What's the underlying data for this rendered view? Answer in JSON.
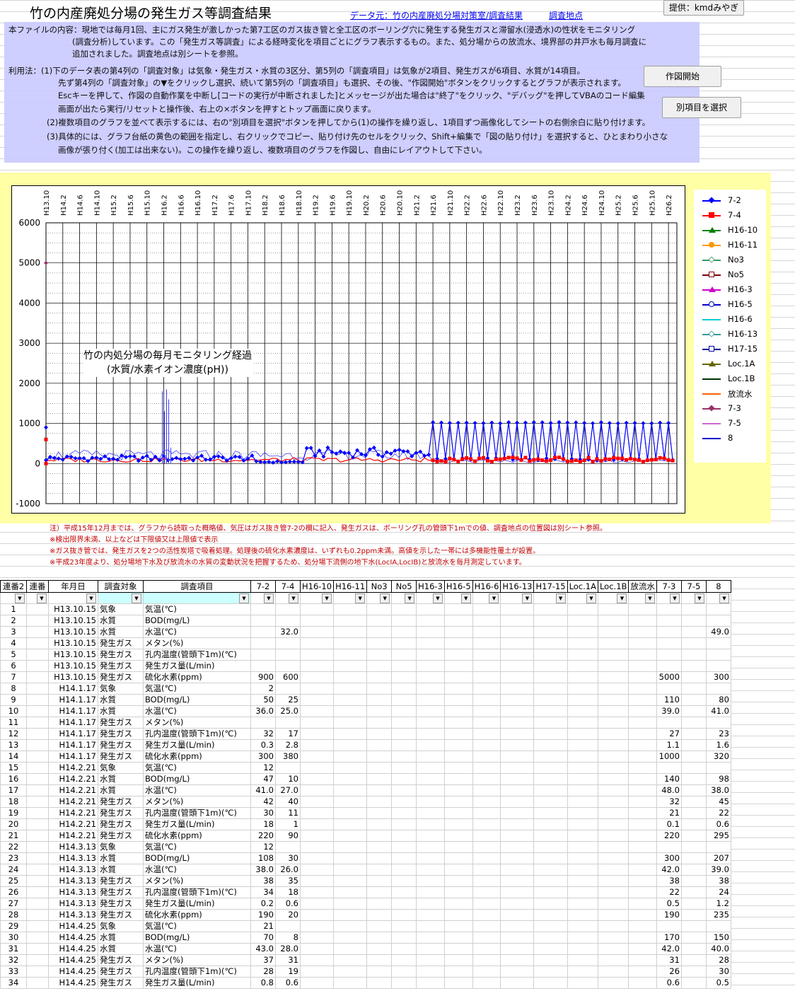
{
  "header": {
    "title": "竹の内産廃処分場の発生ガス等調査結果",
    "source_link": "データ元：竹の内産廃処分場対策室/調査結果",
    "location_link": "調査地点",
    "provider": "提供：kmdみやぎ"
  },
  "buttons": {
    "draw": "作図開始",
    "select": "別項目を選択"
  },
  "description": [
    "本ファイルの内容：現地では毎月1回、主にガス発生が激しかった第7工区のガス抜き管と全工区のボーリング穴に発生する発生ガスと滞留水(浸透水)の性状をモニタリング",
    "(調査分析)しています。この「発生ガス等調査」による経時変化を項目ごとにグラフ表示するもの。また、処分場からの放流水、境界部の井戸水も毎月調査に",
    "追加されました。調査地点は別シートを参照。",
    "利用法：(1)下のデータ表の第4列の「調査対象」は気象・発生ガス・水質の3区分、第5列の「調査項目」は気象が2項目、発生ガスが6項目、水質が14項目。",
    "先ず第4列の「調査対象」の▼をクリックし選択、続いて第5列の「調査項目」も選択、その後、\"作図開始\"ボタンをクリックするとグラフが表示されます。",
    "Escキーを押して、作図の自動作業を中断し[コードの実行が中断されました]とメッセージが出た場合は\"終了\"をクリック、\"デバッグ\"を押してVBAのコード編集",
    "画面が出たら実行/リセットと操作後、右上の×ボタンを押すとトップ画面に戻ります。",
    "(2)複数項目のグラフを並べて表示するには、右の\"別項目を選択\"ボタンを押してから(1)の操作を繰り返し、1項目ずつ画像化してシートの右側余白に貼り付けます。",
    "(3)具体的には、グラフ台紙の黄色の範囲を指定し、右クリックでコピー、貼り付け先のセルをクリック、Shift+編集で「図の貼り付け」を選択すると、ひとまわり小さな",
    "画像が張り付く(加工は出来ない)。この操作を繰り返し、複数項目のグラフを作図し、自由にレイアウトして下さい。"
  ],
  "chart_data": {
    "type": "line",
    "title": "竹の内処分場の毎月モニタリング経過",
    "subtitle": "(水質/水素イオン濃度(pH))",
    "ylim": [
      -1000,
      6000
    ],
    "yticks": [
      -1000,
      0,
      1000,
      2000,
      3000,
      4000,
      5000,
      6000
    ],
    "x_labels": [
      "H13.10",
      "H14.2",
      "H14.6",
      "H14.10",
      "H15.2",
      "H15.6",
      "H15.10",
      "H16.2",
      "H16.6",
      "H16.10",
      "H17.2",
      "H17.6",
      "H17.10",
      "H18.2",
      "H18.6",
      "H18.10",
      "H19.2",
      "H19.6",
      "H19.10",
      "H20.2",
      "H20.6",
      "H20.10",
      "H21.2",
      "H21.6",
      "H21.10",
      "H22.2",
      "H22.6",
      "H22.10",
      "H23.2",
      "H23.6",
      "H23.10",
      "H24.2",
      "H24.6",
      "H24.10",
      "H25.2",
      "H25.6",
      "H25.10",
      "H26.2"
    ],
    "legend": [
      {
        "name": "7-2",
        "color": "#0000ff",
        "marker": "diamond"
      },
      {
        "name": "7-4",
        "color": "#ff0000",
        "marker": "square"
      },
      {
        "name": "H16-10",
        "color": "#008000",
        "marker": "triangle-open"
      },
      {
        "name": "H16-11",
        "color": "#ff9900",
        "marker": "circle"
      },
      {
        "name": "No3",
        "color": "#339966",
        "marker": "diamond-open"
      },
      {
        "name": "No5",
        "color": "#800000",
        "marker": "square-open"
      },
      {
        "name": "H16-3",
        "color": "#cc00cc",
        "marker": "triangle-open"
      },
      {
        "name": "H16-5",
        "color": "#0000cc",
        "marker": "circle-open"
      },
      {
        "name": "H16-6",
        "color": "#00cccc",
        "marker": "line"
      },
      {
        "name": "H16-13",
        "color": "#339999",
        "marker": "diamond-open"
      },
      {
        "name": "H17-15",
        "color": "#000099",
        "marker": "square-open"
      },
      {
        "name": "Loc.1A",
        "color": "#666600",
        "marker": "triangle-open"
      },
      {
        "name": "Loc.1B",
        "color": "#003300",
        "marker": "x"
      },
      {
        "name": "放流水",
        "color": "#ff6600",
        "marker": "star"
      },
      {
        "name": "7-3",
        "color": "#993366",
        "marker": "diamond"
      },
      {
        "name": "7-5",
        "color": "#cc66cc",
        "marker": "plus"
      },
      {
        "name": "8",
        "color": "#0000cc",
        "marker": "x"
      }
    ]
  },
  "notes": [
    "注）平成15年12月までは、グラフから読取った概略値、気圧はガス抜き管7-2の欄に記入、発生ガスは、ボーリング孔の管頭下1mでの値、調査地点の位置図は別シート参照。",
    "※検出限界未満、以上などは下限値又は上限値で表示",
    "※ガス抜き管では、発生ガスを2つの活性炭塔で吸着処理。処理後の硫化水素濃度は、いずれも0.2ppm未満。高値を示した一帯には多機能性覆土が設置。",
    "※平成23年度より、処分場地下水及び放流水の水質の変動状況を把握するため、処分場下流側の地下水(LocIA,LocIB)と放流水を毎月測定しています。"
  ],
  "table": {
    "headers": [
      "連番2",
      "連番",
      "年月日",
      "調査対象",
      "調査項目",
      "7-2",
      "7-4",
      "H16-10",
      "H16-11",
      "No3",
      "No5",
      "H16-3",
      "H16-5",
      "H16-6",
      "H16-13",
      "H17-15",
      "Loc.1A",
      "Loc.1B",
      "放流水",
      "7-3",
      "7-5",
      "8"
    ],
    "rows": [
      [
        "1",
        "",
        "H13.10.15",
        "気象",
        "気温(℃)",
        "",
        "",
        "",
        "",
        "",
        "",
        "",
        "",
        "",
        "",
        "",
        "",
        "",
        "",
        "",
        "",
        ""
      ],
      [
        "2",
        "",
        "H13.10.15",
        "水質",
        "BOD(mg/L)",
        "",
        "",
        "",
        "",
        "",
        "",
        "",
        "",
        "",
        "",
        "",
        "",
        "",
        "",
        "",
        "",
        ""
      ],
      [
        "3",
        "",
        "H13.10.15",
        "水質",
        "水温(℃)",
        "",
        "32.0",
        "",
        "",
        "",
        "",
        "",
        "",
        "",
        "",
        "",
        "",
        "",
        "",
        "",
        "",
        "49.0"
      ],
      [
        "4",
        "",
        "H13.10.15",
        "発生ガス",
        "メタン(%)",
        "",
        "",
        "",
        "",
        "",
        "",
        "",
        "",
        "",
        "",
        "",
        "",
        "",
        "",
        "",
        "",
        ""
      ],
      [
        "5",
        "",
        "H13.10.15",
        "発生ガス",
        "孔内温度(管頭下1m)(℃)",
        "",
        "",
        "",
        "",
        "",
        "",
        "",
        "",
        "",
        "",
        "",
        "",
        "",
        "",
        "",
        "",
        ""
      ],
      [
        "6",
        "",
        "H13.10.15",
        "発生ガス",
        "発生ガス量(L/min)",
        "",
        "",
        "",
        "",
        "",
        "",
        "",
        "",
        "",
        "",
        "",
        "",
        "",
        "",
        "",
        "",
        ""
      ],
      [
        "7",
        "",
        "H13.10.15",
        "発生ガス",
        "硫化水素(ppm)",
        "900",
        "600",
        "",
        "",
        "",
        "",
        "",
        "",
        "",
        "",
        "",
        "",
        "",
        "",
        "5000",
        "",
        "300"
      ],
      [
        "8",
        "",
        "H14.1.17",
        "気象",
        "気温(℃)",
        "2",
        "",
        "",
        "",
        "",
        "",
        "",
        "",
        "",
        "",
        "",
        "",
        "",
        "",
        "",
        "",
        ""
      ],
      [
        "9",
        "",
        "H14.1.17",
        "水質",
        "BOD(mg/L)",
        "50",
        "25",
        "",
        "",
        "",
        "",
        "",
        "",
        "",
        "",
        "",
        "",
        "",
        "",
        "110",
        "",
        "80"
      ],
      [
        "10",
        "",
        "H14.1.17",
        "水質",
        "水温(℃)",
        "36.0",
        "25.0",
        "",
        "",
        "",
        "",
        "",
        "",
        "",
        "",
        "",
        "",
        "",
        "",
        "39.0",
        "",
        "41.0"
      ],
      [
        "11",
        "",
        "H14.1.17",
        "発生ガス",
        "メタン(%)",
        "",
        "",
        "",
        "",
        "",
        "",
        "",
        "",
        "",
        "",
        "",
        "",
        "",
        "",
        "",
        "",
        ""
      ],
      [
        "12",
        "",
        "H14.1.17",
        "発生ガス",
        "孔内温度(管頭下1m)(℃)",
        "32",
        "17",
        "",
        "",
        "",
        "",
        "",
        "",
        "",
        "",
        "",
        "",
        "",
        "",
        "27",
        "",
        "23"
      ],
      [
        "13",
        "",
        "H14.1.17",
        "発生ガス",
        "発生ガス量(L/min)",
        "0.3",
        "2.8",
        "",
        "",
        "",
        "",
        "",
        "",
        "",
        "",
        "",
        "",
        "",
        "",
        "1.1",
        "",
        "1.6"
      ],
      [
        "14",
        "",
        "H14.1.17",
        "発生ガス",
        "硫化水素(ppm)",
        "300",
        "380",
        "",
        "",
        "",
        "",
        "",
        "",
        "",
        "",
        "",
        "",
        "",
        "",
        "1000",
        "",
        "320"
      ],
      [
        "15",
        "",
        "H14.2.21",
        "気象",
        "気温(℃)",
        "12",
        "",
        "",
        "",
        "",
        "",
        "",
        "",
        "",
        "",
        "",
        "",
        "",
        "",
        "",
        "",
        ""
      ],
      [
        "16",
        "",
        "H14.2.21",
        "水質",
        "BOD(mg/L)",
        "47",
        "10",
        "",
        "",
        "",
        "",
        "",
        "",
        "",
        "",
        "",
        "",
        "",
        "",
        "140",
        "",
        "98"
      ],
      [
        "17",
        "",
        "H14.2.21",
        "水質",
        "水温(℃)",
        "41.0",
        "27.0",
        "",
        "",
        "",
        "",
        "",
        "",
        "",
        "",
        "",
        "",
        "",
        "",
        "48.0",
        "",
        "38.0"
      ],
      [
        "18",
        "",
        "H14.2.21",
        "発生ガス",
        "メタン(%)",
        "42",
        "40",
        "",
        "",
        "",
        "",
        "",
        "",
        "",
        "",
        "",
        "",
        "",
        "",
        "32",
        "",
        "45"
      ],
      [
        "19",
        "",
        "H14.2.21",
        "発生ガス",
        "孔内温度(管頭下1m)(℃)",
        "30",
        "11",
        "",
        "",
        "",
        "",
        "",
        "",
        "",
        "",
        "",
        "",
        "",
        "",
        "21",
        "",
        "22"
      ],
      [
        "20",
        "",
        "H14.2.21",
        "発生ガス",
        "発生ガス量(L/min)",
        "18",
        "1",
        "",
        "",
        "",
        "",
        "",
        "",
        "",
        "",
        "",
        "",
        "",
        "",
        "0.1",
        "",
        "0.6"
      ],
      [
        "21",
        "",
        "H14.2.21",
        "発生ガス",
        "硫化水素(ppm)",
        "220",
        "90",
        "",
        "",
        "",
        "",
        "",
        "",
        "",
        "",
        "",
        "",
        "",
        "",
        "220",
        "",
        "295"
      ],
      [
        "22",
        "",
        "H14.3.13",
        "気象",
        "気温(℃)",
        "12",
        "",
        "",
        "",
        "",
        "",
        "",
        "",
        "",
        "",
        "",
        "",
        "",
        "",
        "",
        "",
        ""
      ],
      [
        "23",
        "",
        "H14.3.13",
        "水質",
        "BOD(mg/L)",
        "108",
        "30",
        "",
        "",
        "",
        "",
        "",
        "",
        "",
        "",
        "",
        "",
        "",
        "",
        "300",
        "",
        "207"
      ],
      [
        "24",
        "",
        "H14.3.13",
        "水質",
        "水温(℃)",
        "38.0",
        "26.0",
        "",
        "",
        "",
        "",
        "",
        "",
        "",
        "",
        "",
        "",
        "",
        "",
        "42.0",
        "",
        "39.0"
      ],
      [
        "25",
        "",
        "H14.3.13",
        "発生ガス",
        "メタン(%)",
        "38",
        "35",
        "",
        "",
        "",
        "",
        "",
        "",
        "",
        "",
        "",
        "",
        "",
        "",
        "38",
        "",
        "38"
      ],
      [
        "26",
        "",
        "H14.3.13",
        "発生ガス",
        "孔内温度(管頭下1m)(℃)",
        "34",
        "18",
        "",
        "",
        "",
        "",
        "",
        "",
        "",
        "",
        "",
        "",
        "",
        "",
        "22",
        "",
        "24"
      ],
      [
        "27",
        "",
        "H14.3.13",
        "発生ガス",
        "発生ガス量(L/min)",
        "0.2",
        "0.6",
        "",
        "",
        "",
        "",
        "",
        "",
        "",
        "",
        "",
        "",
        "",
        "",
        "0.5",
        "",
        "1.2"
      ],
      [
        "28",
        "",
        "H14.3.13",
        "発生ガス",
        "硫化水素(ppm)",
        "190",
        "20",
        "",
        "",
        "",
        "",
        "",
        "",
        "",
        "",
        "",
        "",
        "",
        "",
        "190",
        "",
        "235"
      ],
      [
        "29",
        "",
        "H14.4.25",
        "気象",
        "気温(℃)",
        "21",
        "",
        "",
        "",
        "",
        "",
        "",
        "",
        "",
        "",
        "",
        "",
        "",
        "",
        "",
        "",
        ""
      ],
      [
        "30",
        "",
        "H14.4.25",
        "水質",
        "BOD(mg/L)",
        "70",
        "8",
        "",
        "",
        "",
        "",
        "",
        "",
        "",
        "",
        "",
        "",
        "",
        "",
        "170",
        "",
        "150"
      ],
      [
        "31",
        "",
        "H14.4.25",
        "水質",
        "水温(℃)",
        "43.0",
        "28.0",
        "",
        "",
        "",
        "",
        "",
        "",
        "",
        "",
        "",
        "",
        "",
        "",
        "42.0",
        "",
        "40.0"
      ],
      [
        "32",
        "",
        "H14.4.25",
        "発生ガス",
        "メタン(%)",
        "37",
        "31",
        "",
        "",
        "",
        "",
        "",
        "",
        "",
        "",
        "",
        "",
        "",
        "",
        "31",
        "",
        "28"
      ],
      [
        "33",
        "",
        "H14.4.25",
        "発生ガス",
        "孔内温度(管頭下1m)(℃)",
        "28",
        "19",
        "",
        "",
        "",
        "",
        "",
        "",
        "",
        "",
        "",
        "",
        "",
        "",
        "26",
        "",
        "30"
      ],
      [
        "34",
        "",
        "H14.4.25",
        "発生ガス",
        "発生ガス量(L/min)",
        "0.8",
        "0.6",
        "",
        "",
        "",
        "",
        "",
        "",
        "",
        "",
        "",
        "",
        "",
        "",
        "0.6",
        "",
        "0.5"
      ]
    ]
  }
}
